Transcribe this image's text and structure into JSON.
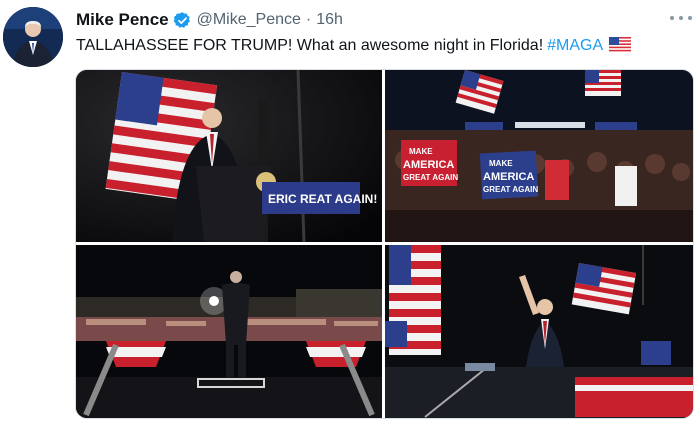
{
  "tweet": {
    "author_name": "Mike Pence",
    "handle": "@Mike_Pence",
    "separator": "·",
    "time": "16h",
    "text": "TALLAHASSEE FOR TRUMP! What an awesome night in Florida!",
    "hashtag": "#MAGA",
    "icons": {
      "verified": "verified-badge-icon",
      "more": "more-options-icon",
      "flag": "us-flag-emoji"
    }
  },
  "photos": [
    {
      "alt": "Speaker at podium under American flag",
      "sign_text": "ERIC    REAT AGAIN!"
    },
    {
      "alt": "Crowd holding signs",
      "sign_text": "MAKE AMERICA GREAT AGAIN"
    },
    {
      "alt": "Stage view of rally crowd"
    },
    {
      "alt": "Speaker waving near flag"
    }
  ],
  "colors": {
    "accent": "#1d9bf0",
    "text": "#0f1419",
    "muted": "#536471"
  }
}
